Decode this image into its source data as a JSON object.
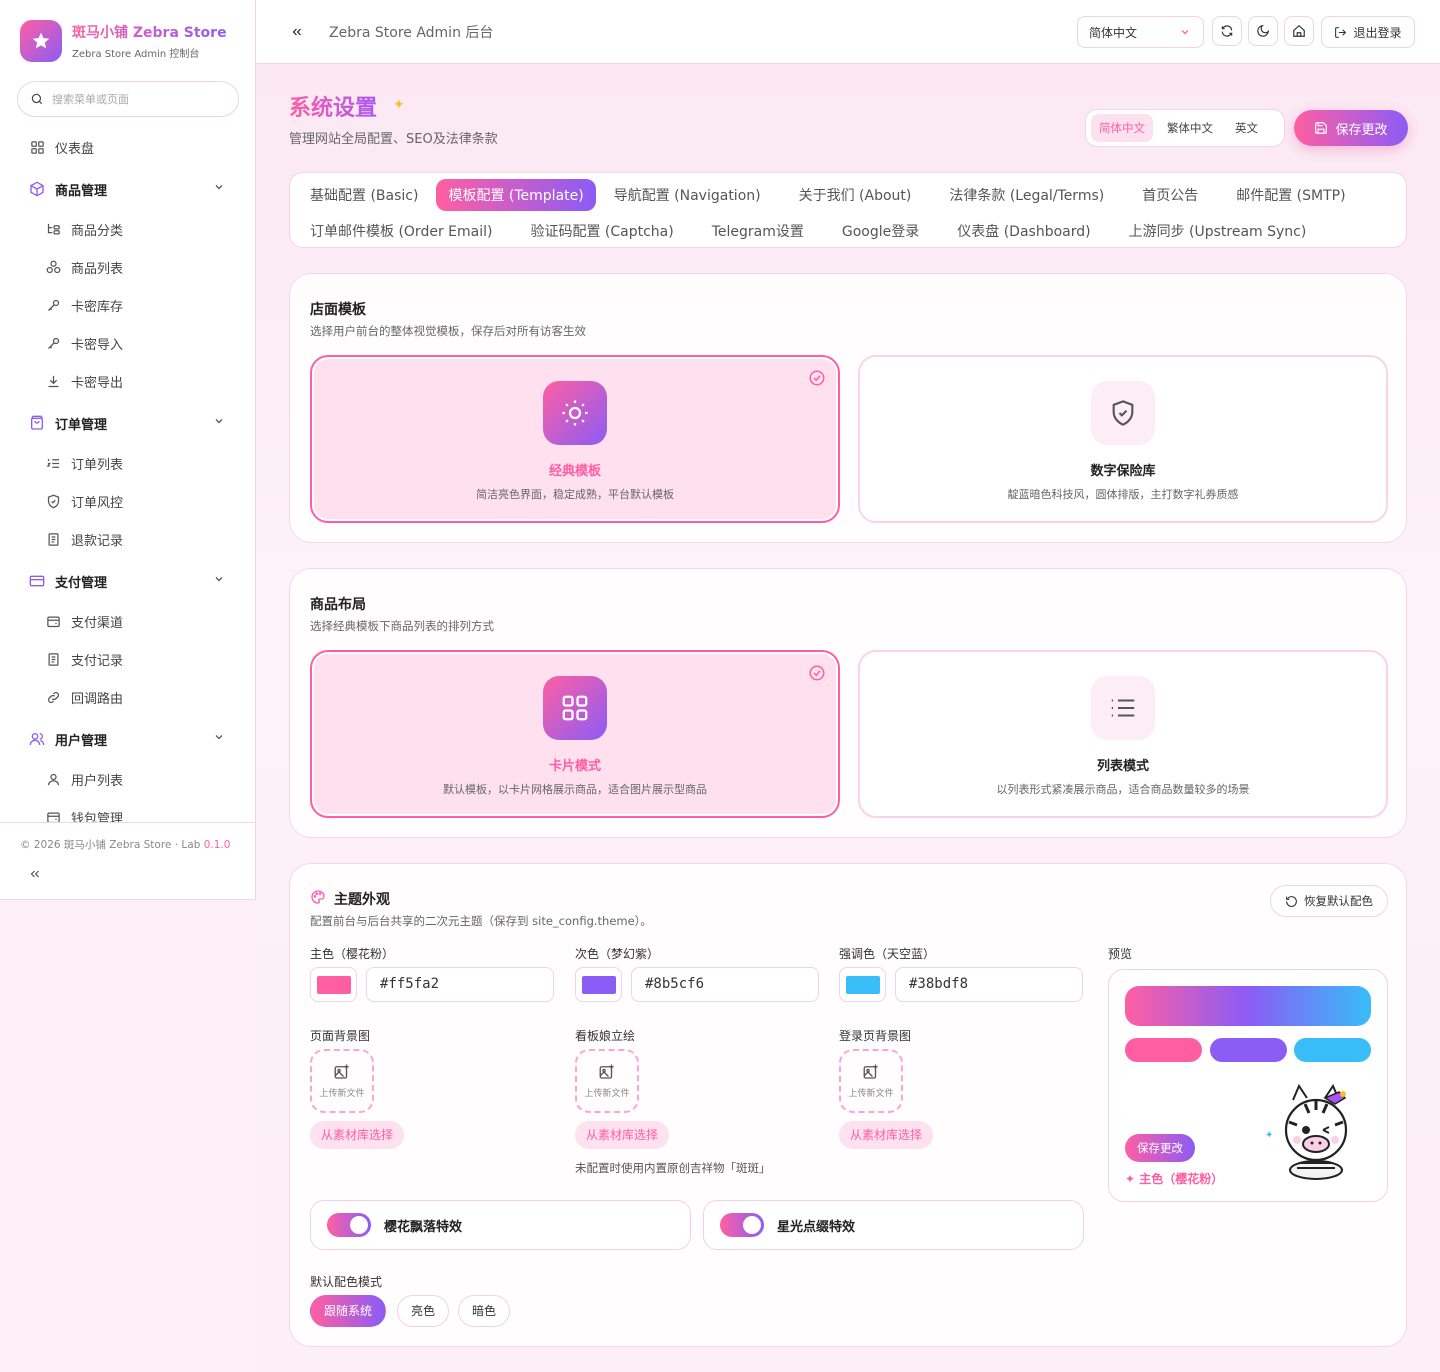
{
  "brand": {
    "title": "斑马小铺 Zebra Store",
    "subtitle": "Zebra Store Admin 控制台"
  },
  "sidebar": {
    "search_placeholder": "搜索菜单或页面",
    "items": [
      {
        "label": "仪表盘",
        "icon": "dashboard-icon",
        "type": "top"
      },
      {
        "label": "商品管理",
        "icon": "box-icon",
        "type": "group"
      },
      {
        "label": "商品分类",
        "icon": "category-tree-icon",
        "type": "sub"
      },
      {
        "label": "商品列表",
        "icon": "shapes-icon",
        "type": "sub"
      },
      {
        "label": "卡密库存",
        "icon": "key-icon",
        "type": "sub"
      },
      {
        "label": "卡密导入",
        "icon": "key-icon",
        "type": "sub"
      },
      {
        "label": "卡密导出",
        "icon": "download-icon",
        "type": "sub"
      },
      {
        "label": "订单管理",
        "icon": "shopping-bag-icon",
        "type": "group"
      },
      {
        "label": "订单列表",
        "icon": "list-ordered-icon",
        "type": "sub"
      },
      {
        "label": "订单风控",
        "icon": "shield-icon",
        "type": "sub"
      },
      {
        "label": "退款记录",
        "icon": "receipt-icon",
        "type": "sub"
      },
      {
        "label": "支付管理",
        "icon": "credit-card-icon",
        "type": "group"
      },
      {
        "label": "支付渠道",
        "icon": "wallet-icon",
        "type": "sub"
      },
      {
        "label": "支付记录",
        "icon": "receipt-icon",
        "type": "sub"
      },
      {
        "label": "回调路由",
        "icon": "link-icon",
        "type": "sub"
      },
      {
        "label": "用户管理",
        "icon": "users-icon",
        "type": "group"
      },
      {
        "label": "用户列表",
        "icon": "user-icon",
        "type": "sub"
      },
      {
        "label": "钱包管理",
        "icon": "wallet-icon",
        "type": "sub"
      }
    ],
    "footer": "© 2026 斑马小铺 Zebra Store · Lab",
    "version": "0.1.0"
  },
  "header": {
    "title": "Zebra Store Admin 后台",
    "language": "简体中文",
    "logout": "退出登录"
  },
  "page": {
    "title": "系统设置",
    "subtitle": "管理网站全局配置、SEO及法律条款",
    "lang_tabs": [
      "简体中文",
      "繁体中文",
      "英文"
    ],
    "save": "保存更改"
  },
  "tabs": {
    "row1": [
      "基础配置 (Basic)",
      "模板配置 (Template)",
      "导航配置 (Navigation)",
      "关于我们 (About)",
      "法律条款 (Legal/Terms)",
      "首页公告",
      "邮件配置 (SMTP)"
    ],
    "row2": [
      "订单邮件模板 (Order Email)",
      "验证码配置 (Captcha)",
      "Telegram设置",
      "Google登录",
      "仪表盘 (Dashboard)",
      "上游同步 (Upstream Sync)"
    ],
    "active": "模板配置 (Template)"
  },
  "storefront": {
    "title": "店面模板",
    "subtitle": "选择用户前台的整体视觉模板，保存后对所有访客生效",
    "options": [
      {
        "name": "经典模板",
        "desc": "简洁亮色界面，稳定成熟，平台默认模板",
        "selected": true
      },
      {
        "name": "数字保险库",
        "desc": "靛蓝暗色科技风，圆体排版，主打数字礼券质感",
        "selected": false
      }
    ]
  },
  "layout": {
    "title": "商品布局",
    "subtitle": "选择经典模板下商品列表的排列方式",
    "options": [
      {
        "name": "卡片模式",
        "desc": "默认模板，以卡片网格展示商品，适合图片展示型商品",
        "selected": true
      },
      {
        "name": "列表模式",
        "desc": "以列表形式紧凑展示商品，适合商品数量较多的场景",
        "selected": false
      }
    ]
  },
  "theme": {
    "title": "主题外观",
    "subtitle": "配置前台与后台共享的二次元主题（保存到 site_config.theme）。",
    "restore": "恢复默认配色",
    "colors": [
      {
        "label": "主色（樱花粉）",
        "value": "#ff5fa2"
      },
      {
        "label": "次色（梦幻紫）",
        "value": "#8b5cf6"
      },
      {
        "label": "强调色（天空蓝）",
        "value": "#38bdf8"
      }
    ],
    "uploads": [
      {
        "label": "页面背景图",
        "upload": "上传新文件",
        "pick": "从素材库选择"
      },
      {
        "label": "看板娘立绘",
        "upload": "上传新文件",
        "pick": "从素材库选择"
      },
      {
        "label": "登录页背景图",
        "upload": "上传新文件",
        "pick": "从素材库选择"
      }
    ],
    "mascot_hint": "未配置时使用内置原创吉祥物「斑斑」",
    "preview_label": "预览",
    "preview_button": "保存更改",
    "preview_primary": "✦ 主色（樱花粉）",
    "toggles": [
      {
        "label": "樱花飘落特效",
        "on": true
      },
      {
        "label": "星光点缀特效",
        "on": true
      }
    ],
    "mode_label": "默认配色模式",
    "modes": [
      "跟随系统",
      "亮色",
      "暗色"
    ],
    "mode_active": "跟随系统"
  }
}
